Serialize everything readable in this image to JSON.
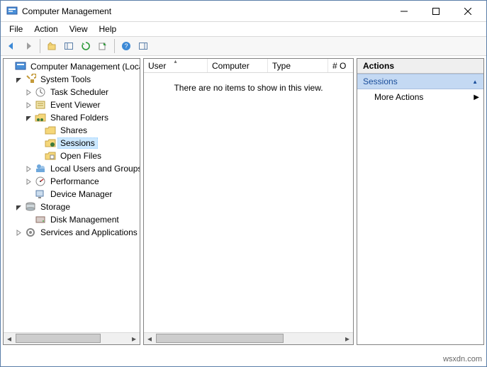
{
  "window": {
    "title": "Computer Management"
  },
  "menu": {
    "file": "File",
    "action": "Action",
    "view": "View",
    "help": "Help"
  },
  "tree": {
    "root": "Computer Management (Local)",
    "system_tools": "System Tools",
    "task_scheduler": "Task Scheduler",
    "event_viewer": "Event Viewer",
    "shared_folders": "Shared Folders",
    "shares": "Shares",
    "sessions": "Sessions",
    "open_files": "Open Files",
    "local_users": "Local Users and Groups",
    "performance": "Performance",
    "device_manager": "Device Manager",
    "storage": "Storage",
    "disk_management": "Disk Management",
    "services_apps": "Services and Applications"
  },
  "list": {
    "columns": {
      "user": "User",
      "computer": "Computer",
      "type": "Type",
      "open": "# O"
    },
    "empty_msg": "There are no items to show in this view."
  },
  "actions": {
    "title": "Actions",
    "section": "Sessions",
    "more": "More Actions"
  },
  "watermark": "wsxdn.com"
}
